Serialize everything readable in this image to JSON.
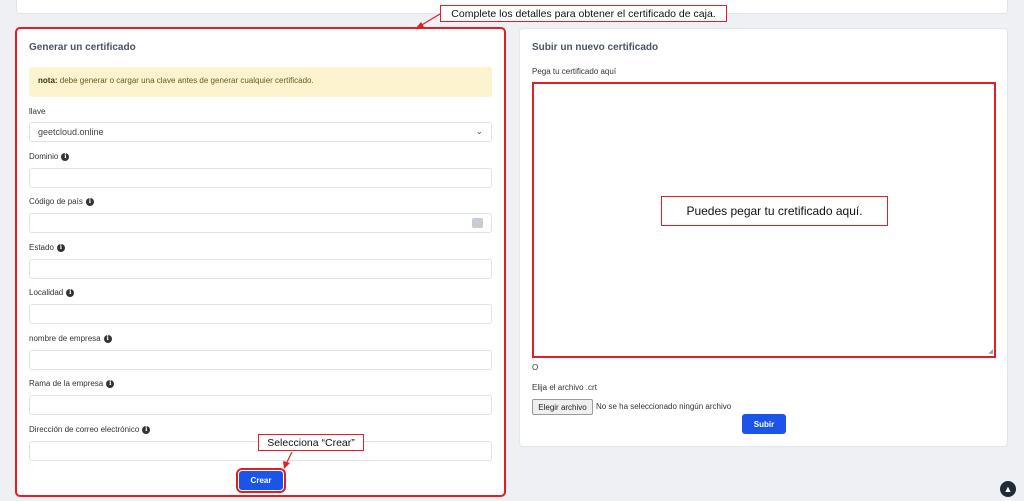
{
  "generate": {
    "title": "Generar un certificado",
    "note_label": "nota:",
    "note_text": " debe generar o cargar una clave antes de generar cualquier certificado.",
    "key_label": "llave",
    "key_value": "geetcloud.online",
    "domain_label": "Dominio",
    "country_label": "Código de país",
    "state_label": "Estado",
    "locality_label": "Localidad",
    "company_label": "nombre de empresa",
    "branch_label": "Rama de la empresa",
    "email_label": "Dirección de correo electrónico",
    "create_button": "Crear"
  },
  "upload": {
    "title": "Subir un nuevo certificado",
    "paste_label": "Pega tu certificado aquí",
    "or_text": "O",
    "file_label": "Elija el archivo .crt",
    "file_button": "Elegir archivo",
    "file_status": "No se ha seleccionado ningún archivo",
    "upload_button": "Subir"
  },
  "annotations": {
    "top": "Complete los detalles para obtener el certificado de caja.",
    "paste": "Puedes pegar tu cretificado aquí.",
    "create": "Selecciona “Crear”"
  },
  "icons": {
    "info": "info-icon",
    "chevron": "chevron-down-icon",
    "calendar": "calendar-icon",
    "scroll_top": "chevron-up-icon"
  },
  "colors": {
    "primary": "#1b54e8",
    "annotation": "#e01e26",
    "note_bg": "#fdf3cf"
  }
}
